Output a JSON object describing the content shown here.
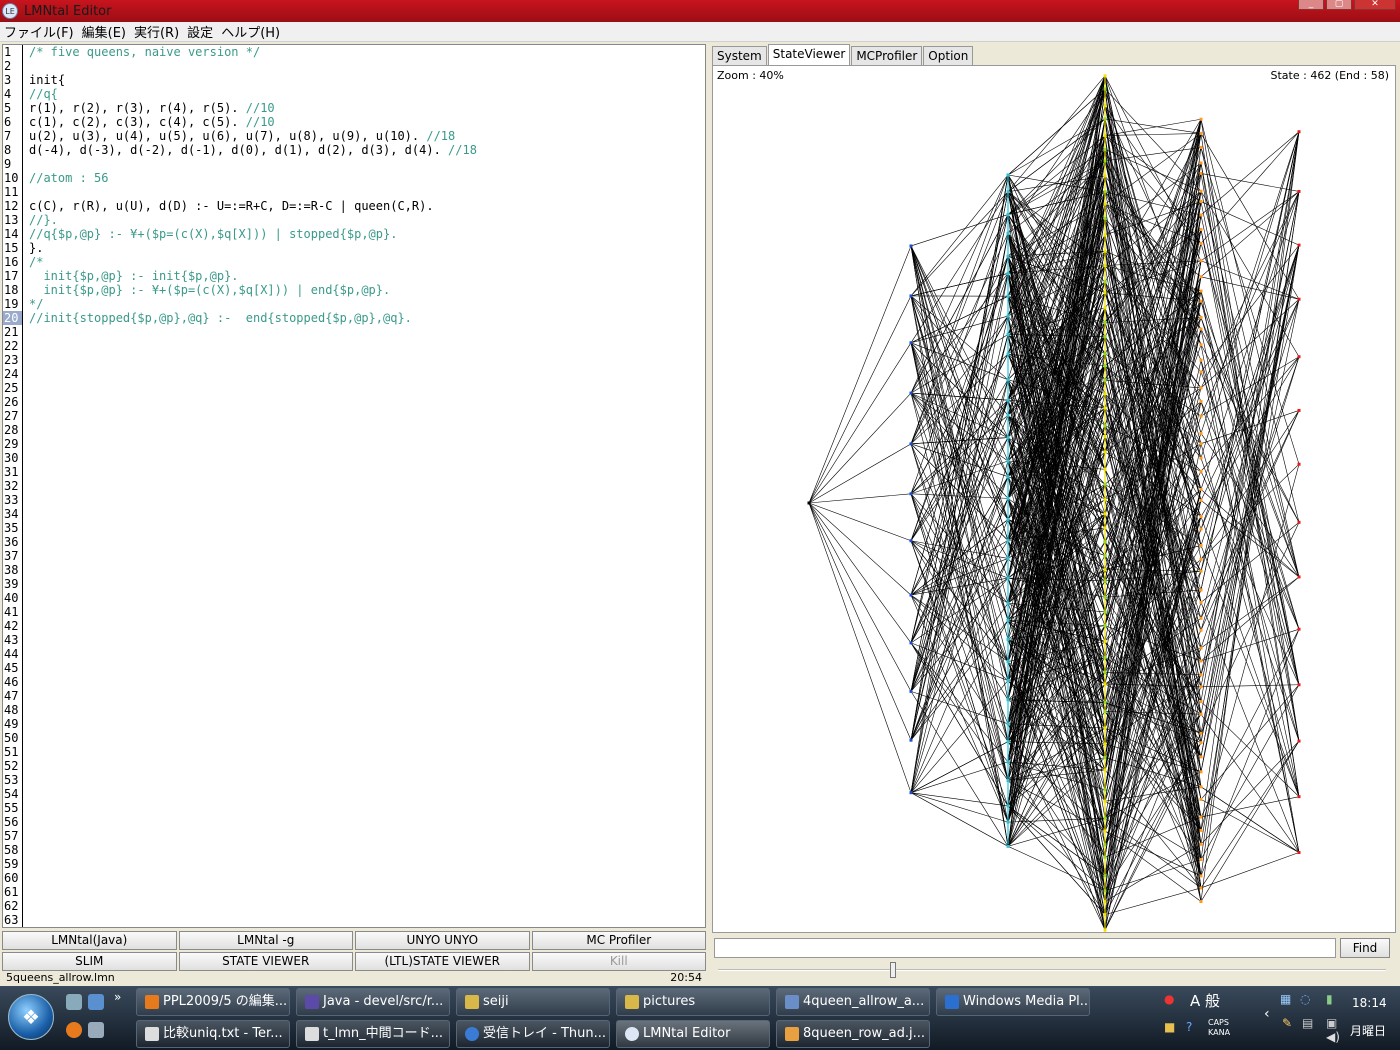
{
  "window": {
    "title": "LMNtal Editor",
    "icon": "app-icon"
  },
  "menu": [
    "ファイル(F)",
    "編集(E)",
    "実行(R)",
    "設定",
    "ヘルプ(H)"
  ],
  "editor": {
    "current_line": 20,
    "lines": [
      {
        "t": "/* five queens, naive version */",
        "c": true
      },
      {
        "t": "",
        "c": false
      },
      {
        "t": "init{",
        "c": false
      },
      {
        "t": "//q{",
        "c": true
      },
      {
        "t": "r(1), r(2), r(3), r(4), r(5). ",
        "c": false,
        "cm": "//10"
      },
      {
        "t": "c(1), c(2), c(3), c(4), c(5). ",
        "c": false,
        "cm": "//10"
      },
      {
        "t": "u(2), u(3), u(4), u(5), u(6), u(7), u(8), u(9), u(10). ",
        "c": false,
        "cm": "//18"
      },
      {
        "t": "d(-4), d(-3), d(-2), d(-1), d(0), d(1), d(2), d(3), d(4). ",
        "c": false,
        "cm": "//18"
      },
      {
        "t": "",
        "c": false
      },
      {
        "t": "//atom : 56",
        "c": true
      },
      {
        "t": "",
        "c": false
      },
      {
        "t": "c(C), r(R), u(U), d(D) :- U=:=R+C, D=:=R-C | queen(C,R).",
        "c": false
      },
      {
        "t": "//}.",
        "c": true
      },
      {
        "t": "//q{$p,@p} :- ¥+($p=(c(X),$q[X])) | stopped{$p,@p}.",
        "c": true
      },
      {
        "t": "}.",
        "c": false
      },
      {
        "t": "/*",
        "c": true
      },
      {
        "t": "  init{$p,@p} :- init{$p,@p}.",
        "c": true
      },
      {
        "t": "  init{$p,@p} :- ¥+($p=(c(X),$q[X])) | end{$p,@p}.",
        "c": true
      },
      {
        "t": "*/",
        "c": true
      },
      {
        "t": "//init{stopped{$p,@p},@q} :-  end{stopped{$p,@p},@q}.",
        "c": true
      }
    ],
    "total_lines": 63
  },
  "buttons": {
    "row1": [
      "LMNtal(Java)",
      "LMNtal -g",
      "UNYO UNYO",
      "MC Profiler"
    ],
    "row2": [
      "SLIM",
      "STATE VIEWER",
      "(LTL)STATE VIEWER",
      "Kill"
    ]
  },
  "status": {
    "file": "5queens_allrow.lmn",
    "position": "20:54"
  },
  "tabs": [
    "System",
    "StateViewer",
    "MCProfiler",
    "Option"
  ],
  "active_tab": "StateViewer",
  "viewer": {
    "zoom": "Zoom : 40%",
    "state": "State : 462 (End : 58)"
  },
  "find": {
    "button": "Find",
    "value": ""
  },
  "taskbar": {
    "row1": [
      "PPL2009/5 の編集...",
      "Java - devel/src/r...",
      "seiji",
      "pictures",
      "4queen_allrow_a...",
      "Windows Media Pl..."
    ],
    "row2": [
      "比較uniq.txt - Ter...",
      "t_lmn_中間コード...",
      "受信トレイ - Thun...",
      "LMNtal Editor",
      "8queen_row_ad.j..."
    ],
    "active": "LMNtal Editor",
    "clock": "18:14",
    "day": "月曜日",
    "ime": "A 般",
    "caps": "CAPS",
    "kana": "KANA"
  }
}
